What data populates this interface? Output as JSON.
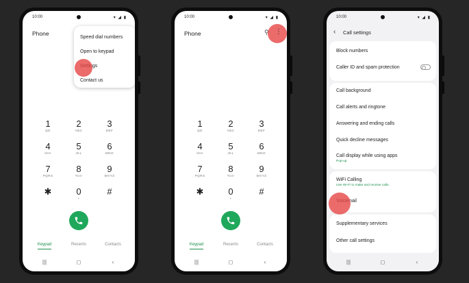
{
  "status": {
    "time": "10:00",
    "icons": "▾ ◢ ▮"
  },
  "phone1": {
    "title": "Phone",
    "menu": [
      "Speed dial numbers",
      "Open to keypad",
      "Settings",
      "Contact us"
    ]
  },
  "phone2": {
    "title": "Phone",
    "search_icon": "⚲",
    "more_icon": "⋮"
  },
  "keypad": [
    {
      "digit": "1",
      "letters": "QD"
    },
    {
      "digit": "2",
      "letters": "ABC"
    },
    {
      "digit": "3",
      "letters": "DEF"
    },
    {
      "digit": "4",
      "letters": "GHI"
    },
    {
      "digit": "5",
      "letters": "JKL"
    },
    {
      "digit": "6",
      "letters": "MNO"
    },
    {
      "digit": "7",
      "letters": "PQRS"
    },
    {
      "digit": "8",
      "letters": "TUV"
    },
    {
      "digit": "9",
      "letters": "WXYZ"
    },
    {
      "digit": "✱",
      "letters": ""
    },
    {
      "digit": "0",
      "letters": "+"
    },
    {
      "digit": "#",
      "letters": ""
    }
  ],
  "tabs": [
    "Keypad",
    "Recents",
    "Contacts"
  ],
  "nav": {
    "recents": "|||",
    "home": "◻",
    "back": "‹"
  },
  "settings": {
    "back_icon": "‹",
    "title": "Call settings",
    "block_numbers": "Block numbers",
    "caller_id": "Caller ID and spam protection",
    "call_background": "Call background",
    "call_alerts": "Call alerts and ringtone",
    "answering": "Answering and ending calls",
    "quick_decline": "Quick decline messages",
    "call_display": "Call display while using apps",
    "call_display_sub": "Pop-up",
    "wifi_calling": "WiFi Calling",
    "wifi_calling_sub": "Use Wi-Fi to make and receive calls.",
    "voicemail": "Voicemail",
    "supplementary": "Supplementary services",
    "other": "Other call settings"
  },
  "colors": {
    "accent": "#1a8f49",
    "call_button": "#1fa85b",
    "tap_highlight": "#e64646"
  }
}
